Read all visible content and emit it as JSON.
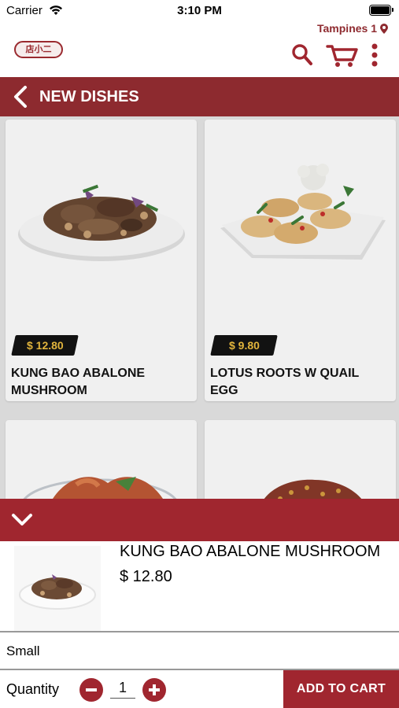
{
  "status_bar": {
    "carrier": "Carrier",
    "time": "3:10 PM"
  },
  "header": {
    "location": "Tampines 1",
    "logo_text": "店小二"
  },
  "page": {
    "title": "NEW DISHES"
  },
  "dishes": [
    {
      "price": "$ 12.80",
      "name": "KUNG BAO ABALONE MUSHROOM"
    },
    {
      "price": "$ 9.80",
      "name": "LOTUS ROOTS W QUAIL EGG"
    }
  ],
  "sheet": {
    "name": "KUNG BAO ABALONE MUSHROOM",
    "price": "$ 12.80",
    "size": "Small",
    "quantity_label": "Quantity",
    "quantity": "1",
    "add_to_cart": "ADD TO CART"
  },
  "colors": {
    "brand": "#8d2a2f",
    "sheet_accent": "#a0262f",
    "price_tag_text": "#f0c040"
  },
  "icons": [
    "wifi-icon",
    "battery-icon",
    "location-pin-icon",
    "search-icon",
    "cart-icon",
    "more-vertical-icon",
    "back-chevron-icon",
    "chevron-down-icon",
    "minus-icon",
    "plus-icon"
  ]
}
